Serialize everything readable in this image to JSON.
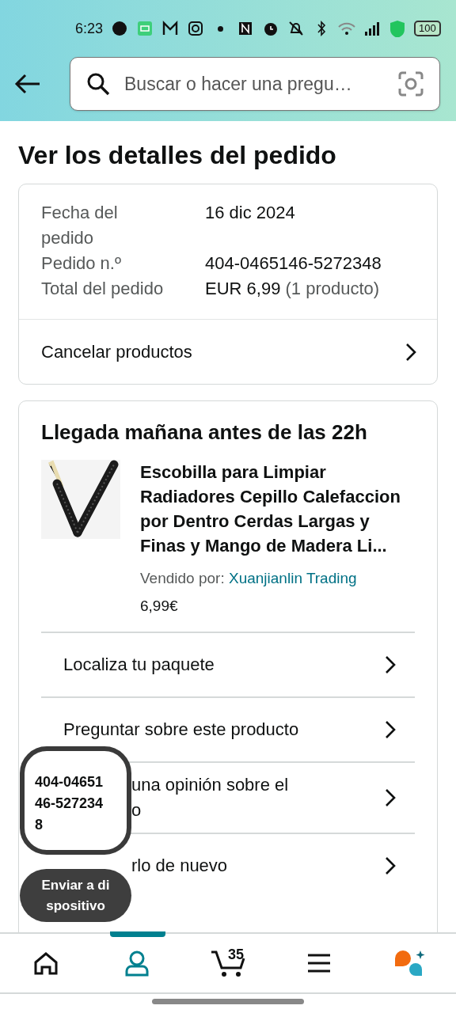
{
  "status_bar": {
    "time": "6:23",
    "battery": "100"
  },
  "search": {
    "placeholder": "Buscar o hacer una pregu…"
  },
  "title": "Ver los detalles del pedido",
  "order_summary": {
    "rows": [
      {
        "label": "Fecha del pedido",
        "value": "16 dic 2024"
      },
      {
        "label": "Pedido n.º",
        "value": "404-0465146-5272348"
      },
      {
        "label": "Total del pedido",
        "value": "EUR 6,99",
        "note": "(1 producto)"
      }
    ],
    "action": "Cancelar productos"
  },
  "shipment": {
    "heading": "Llegada mañana antes de las 22h",
    "product": {
      "name": "Escobilla para Limpiar Radiadores Cepillo Calefaccion por Dentro Cerdas Largas y Finas y Mango de Madera Li...",
      "sold_by_label": "Vendido por:",
      "seller": "Xuanjianlin Trading",
      "price": "6,99€"
    },
    "actions": [
      {
        "kind": "full",
        "lines": [
          "Localiza tu paquete"
        ]
      },
      {
        "kind": "full",
        "lines": [
          "Preguntar sobre este producto"
        ]
      },
      {
        "kind": "clipped",
        "lines": [
          "una opinión sobre el",
          "o"
        ]
      },
      {
        "kind": "clipped",
        "lines": [
          "rlo de nuevo"
        ]
      }
    ]
  },
  "floating_bubbles": [
    {
      "kind": "copied",
      "lines": [
        "404-04651",
        "46-527234",
        "8"
      ]
    },
    {
      "kind": "send",
      "lines": [
        "Enviar a di",
        "spositivo"
      ]
    }
  ],
  "bottom_nav": [
    {
      "kind": "home",
      "selected": false
    },
    {
      "kind": "account",
      "selected": true
    },
    {
      "kind": "cart",
      "count": "35",
      "selected": false
    },
    {
      "kind": "menu",
      "selected": false
    },
    {
      "kind": "assistant",
      "selected": false
    }
  ]
}
